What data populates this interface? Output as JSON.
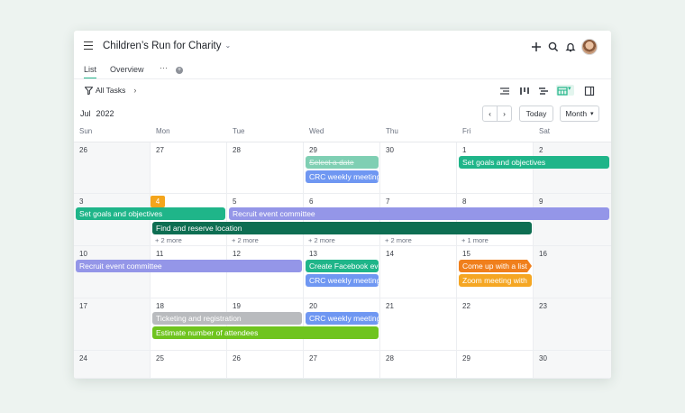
{
  "header": {
    "title": "Children’s Run for Charity",
    "title_chevron": "⌄",
    "menu_icon": "hamburger-icon",
    "actions": [
      "plus-icon",
      "search-icon",
      "bell-icon",
      "avatar"
    ]
  },
  "tabs": [
    {
      "label": "List",
      "active": true
    },
    {
      "label": "Overview",
      "active": false
    }
  ],
  "tab_more": "···",
  "tab_add": "+",
  "toolbar": {
    "filter_label": "All Tasks",
    "filter_caret": "›",
    "view_icons": [
      "list-view-icon",
      "board-view-icon",
      "gantt-view-icon",
      "calendar-view-icon",
      "side-panel-icon"
    ],
    "calendar_caret": "▾"
  },
  "nav": {
    "month": "Jul",
    "year": "2022",
    "prev": "‹",
    "next": "›",
    "today_label": "Today",
    "view_select": "Month",
    "view_caret": "▾"
  },
  "day_names": [
    "Sun",
    "Mon",
    "Tue",
    "Wed",
    "Thu",
    "Fri",
    "Sat"
  ],
  "weeks": [
    {
      "days": [
        "26",
        "27",
        "28",
        "29",
        "30",
        "1",
        "2"
      ],
      "more": [
        "",
        "",
        "",
        "",
        "",
        "",
        ""
      ]
    },
    {
      "days": [
        "3",
        "4",
        "5",
        "6",
        "7",
        "8",
        "9"
      ],
      "more": [
        "",
        "+ 2 more",
        "+ 2 more",
        "+ 2 more",
        "+ 2 more",
        "+ 1 more",
        ""
      ]
    },
    {
      "days": [
        "10",
        "11",
        "12",
        "13",
        "14",
        "15",
        "16"
      ],
      "more": [
        "",
        "",
        "",
        "",
        "",
        "",
        ""
      ]
    },
    {
      "days": [
        "17",
        "18",
        "19",
        "20",
        "21",
        "22",
        "23"
      ],
      "more": [
        "",
        "",
        "",
        "",
        "",
        "",
        ""
      ]
    },
    {
      "days": [
        "24",
        "25",
        "26",
        "27",
        "28",
        "29",
        "30"
      ],
      "more": [
        "",
        "",
        "",
        "",
        "",
        "",
        ""
      ]
    }
  ],
  "today": "4",
  "events": [
    {
      "label": "Select a date",
      "color": "#7fcfb3",
      "week": 0,
      "start": 3,
      "span": 1,
      "lane": 0,
      "strike": true,
      "arrow": false
    },
    {
      "label": "CRC weekly meeting",
      "color": "#6f97f2",
      "week": 0,
      "start": 3,
      "span": 1,
      "lane": 1,
      "strike": false,
      "arrow": false
    },
    {
      "label": "Set goals and objectives",
      "color": "#1fb589",
      "week": 0,
      "start": 5,
      "span": 2,
      "lane": 0,
      "strike": false,
      "arrow": false
    },
    {
      "label": "Set goals and objectives",
      "color": "#1fb589",
      "week": 1,
      "start": 0,
      "span": 2,
      "lane": 0,
      "strike": false,
      "arrow": false
    },
    {
      "label": "Recruit event committee",
      "color": "#9496e8",
      "week": 1,
      "start": 2,
      "span": 5,
      "lane": 0,
      "strike": false,
      "arrow": false
    },
    {
      "label": "Find and reserve location",
      "color": "#0e6e52",
      "week": 1,
      "start": 1,
      "span": 5,
      "lane": 1,
      "strike": false,
      "arrow": false
    },
    {
      "label": "Recruit event committee",
      "color": "#9496e8",
      "week": 2,
      "start": 0,
      "span": 3,
      "lane": 0,
      "strike": false,
      "arrow": false
    },
    {
      "label": "Create Facebook event",
      "color": "#1fb589",
      "week": 2,
      "start": 3,
      "span": 1,
      "lane": 0,
      "strike": false,
      "arrow": false
    },
    {
      "label": "CRC weekly meeting",
      "color": "#6f97f2",
      "week": 2,
      "start": 3,
      "span": 1,
      "lane": 1,
      "strike": false,
      "arrow": false
    },
    {
      "label": "Come up with a list",
      "color": "#f07f1c",
      "week": 2,
      "start": 5,
      "span": 1,
      "lane": 0,
      "strike": false,
      "arrow": true
    },
    {
      "label": "Zoom meeting with",
      "color": "#f5a623",
      "week": 2,
      "start": 5,
      "span": 1,
      "lane": 1,
      "strike": false,
      "arrow": false
    },
    {
      "label": "Ticketing and registration",
      "color": "#b9bbbe",
      "week": 3,
      "start": 1,
      "span": 2,
      "lane": 0,
      "strike": false,
      "arrow": false
    },
    {
      "label": "CRC weekly meeting",
      "color": "#6f97f2",
      "week": 3,
      "start": 3,
      "span": 1,
      "lane": 0,
      "strike": false,
      "arrow": false
    },
    {
      "label": "Estimate number of attendees",
      "color": "#6fc41f",
      "week": 3,
      "start": 1,
      "span": 3,
      "lane": 1,
      "strike": false,
      "arrow": false
    }
  ]
}
